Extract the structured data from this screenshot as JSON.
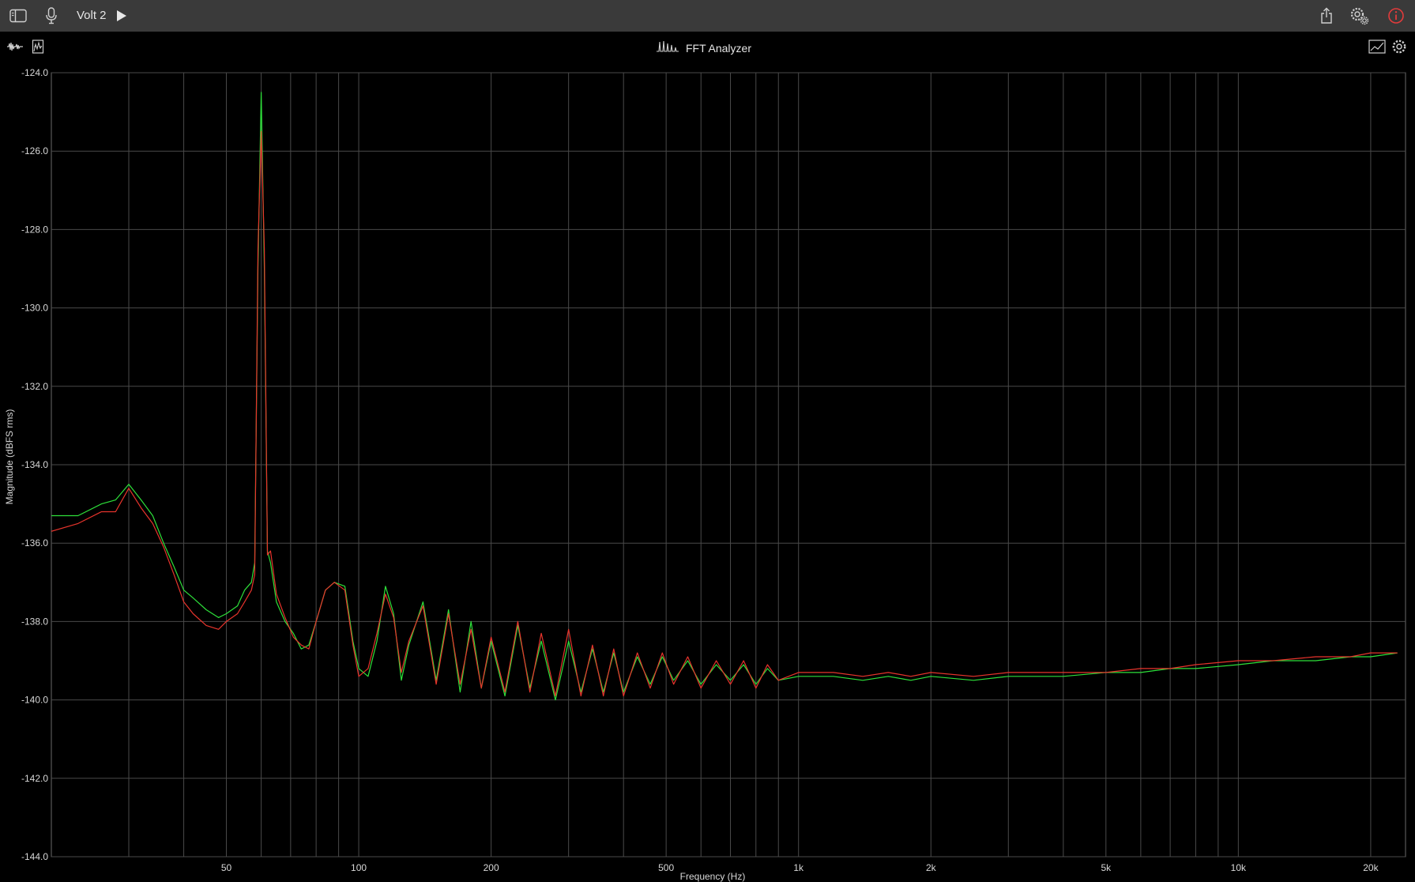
{
  "titlebar": {
    "title": "Volt 2",
    "icons": [
      "sidebar-icon",
      "microphone-icon",
      "play-icon",
      "share-icon",
      "settings-gear-icon",
      "info-icon"
    ],
    "info_color": "#e23b3b"
  },
  "subbar": {
    "title": "FFT Analyzer",
    "icons": [
      "waveform-icon",
      "spectrum-bars-icon",
      "fft-peaks-icon",
      "chart-line-icon",
      "gear-icon"
    ]
  },
  "chart_data": {
    "type": "line",
    "title": "",
    "xlabel": "Frequency (Hz)",
    "ylabel": "Magnitude (dBFS rms)",
    "x_scale": "log",
    "xlim": [
      20,
      24000
    ],
    "ylim": [
      -144,
      -124
    ],
    "grid": true,
    "y_ticks": [
      -124,
      -126,
      -128,
      -130,
      -132,
      -134,
      -136,
      -138,
      -140,
      -142,
      -144
    ],
    "y_tick_labels": [
      "-124.0",
      "-126.0",
      "-128.0",
      "-130.0",
      "-132.0",
      "-134.0",
      "-136.0",
      "-138.0",
      "-140.0",
      "-142.0",
      "-144.0"
    ],
    "x_tick_labels": [
      {
        "v": 50,
        "label": "50"
      },
      {
        "v": 100,
        "label": "100"
      },
      {
        "v": 200,
        "label": "200"
      },
      {
        "v": 500,
        "label": "500"
      },
      {
        "v": 1000,
        "label": "1k"
      },
      {
        "v": 2000,
        "label": "2k"
      },
      {
        "v": 5000,
        "label": "5k"
      },
      {
        "v": 10000,
        "label": "10k"
      },
      {
        "v": 20000,
        "label": "20k"
      }
    ],
    "series": [
      {
        "color": "#2ee03a",
        "x": [
          20,
          23,
          26,
          28,
          30,
          32,
          34,
          36,
          38,
          40,
          42,
          45,
          48,
          50,
          53,
          55,
          57,
          58,
          59,
          60,
          61,
          62,
          63,
          65,
          68,
          71,
          74,
          77,
          80,
          84,
          88,
          93,
          97,
          100,
          105,
          110,
          115,
          120,
          125,
          130,
          140,
          150,
          160,
          170,
          180,
          190,
          200,
          215,
          230,
          245,
          260,
          280,
          300,
          320,
          340,
          360,
          380,
          400,
          430,
          460,
          490,
          520,
          560,
          600,
          650,
          700,
          750,
          800,
          850,
          900,
          1000,
          1200,
          1400,
          1600,
          1800,
          2000,
          2500,
          3000,
          3500,
          4000,
          5000,
          6000,
          7000,
          8000,
          10000,
          12000,
          15000,
          18000,
          20000,
          23000
        ],
        "y": [
          -135.3,
          -135.3,
          -135.0,
          -134.9,
          -134.5,
          -134.9,
          -135.3,
          -136.0,
          -136.6,
          -137.2,
          -137.4,
          -137.7,
          -137.9,
          -137.8,
          -137.6,
          -137.2,
          -137.0,
          -136.5,
          -129.0,
          -124.5,
          -129.0,
          -136.2,
          -136.5,
          -137.5,
          -138.0,
          -138.3,
          -138.7,
          -138.6,
          -138.0,
          -137.2,
          -137.0,
          -137.1,
          -138.5,
          -139.2,
          -139.4,
          -138.5,
          -137.1,
          -137.8,
          -139.5,
          -138.6,
          -137.5,
          -139.5,
          -137.7,
          -139.8,
          -138.0,
          -139.7,
          -138.5,
          -139.9,
          -138.1,
          -139.7,
          -138.5,
          -140.0,
          -138.5,
          -139.8,
          -138.7,
          -139.8,
          -138.8,
          -139.8,
          -138.9,
          -139.6,
          -138.9,
          -139.5,
          -139.0,
          -139.6,
          -139.1,
          -139.5,
          -139.1,
          -139.6,
          -139.2,
          -139.5,
          -139.4,
          -139.4,
          -139.5,
          -139.4,
          -139.5,
          -139.4,
          -139.5,
          -139.4,
          -139.4,
          -139.4,
          -139.3,
          -139.3,
          -139.2,
          -139.2,
          -139.1,
          -139.0,
          -139.0,
          -138.9,
          -138.9,
          -138.8
        ]
      },
      {
        "color": "#e8342c",
        "x": [
          20,
          23,
          26,
          28,
          30,
          32,
          34,
          36,
          38,
          40,
          42,
          45,
          48,
          50,
          53,
          55,
          57,
          58,
          59,
          60,
          61,
          62,
          63,
          65,
          68,
          71,
          74,
          77,
          80,
          84,
          88,
          93,
          97,
          100,
          105,
          110,
          115,
          120,
          125,
          130,
          140,
          150,
          160,
          170,
          180,
          190,
          200,
          215,
          230,
          245,
          260,
          280,
          300,
          320,
          340,
          360,
          380,
          400,
          430,
          460,
          490,
          520,
          560,
          600,
          650,
          700,
          750,
          800,
          850,
          900,
          1000,
          1200,
          1400,
          1600,
          1800,
          2000,
          2500,
          3000,
          3500,
          4000,
          5000,
          6000,
          7000,
          8000,
          10000,
          12000,
          15000,
          18000,
          20000,
          23000
        ],
        "y": [
          -135.7,
          -135.5,
          -135.2,
          -135.2,
          -134.6,
          -135.1,
          -135.5,
          -136.1,
          -136.8,
          -137.5,
          -137.8,
          -138.1,
          -138.2,
          -138.0,
          -137.8,
          -137.5,
          -137.2,
          -136.8,
          -128.5,
          -125.5,
          -128.5,
          -136.3,
          -136.2,
          -137.3,
          -137.9,
          -138.4,
          -138.6,
          -138.7,
          -138.0,
          -137.2,
          -137.0,
          -137.2,
          -138.6,
          -139.4,
          -139.2,
          -138.3,
          -137.3,
          -137.9,
          -139.3,
          -138.5,
          -137.6,
          -139.6,
          -137.8,
          -139.6,
          -138.2,
          -139.7,
          -138.4,
          -139.8,
          -138.0,
          -139.8,
          -138.3,
          -139.9,
          -138.2,
          -139.9,
          -138.6,
          -139.9,
          -138.7,
          -139.9,
          -138.8,
          -139.7,
          -138.8,
          -139.6,
          -138.9,
          -139.7,
          -139.0,
          -139.6,
          -139.0,
          -139.7,
          -139.1,
          -139.5,
          -139.3,
          -139.3,
          -139.4,
          -139.3,
          -139.4,
          -139.3,
          -139.4,
          -139.3,
          -139.3,
          -139.3,
          -139.3,
          -139.2,
          -139.2,
          -139.1,
          -139.0,
          -139.0,
          -138.9,
          -138.9,
          -138.8,
          -138.8
        ]
      }
    ]
  }
}
